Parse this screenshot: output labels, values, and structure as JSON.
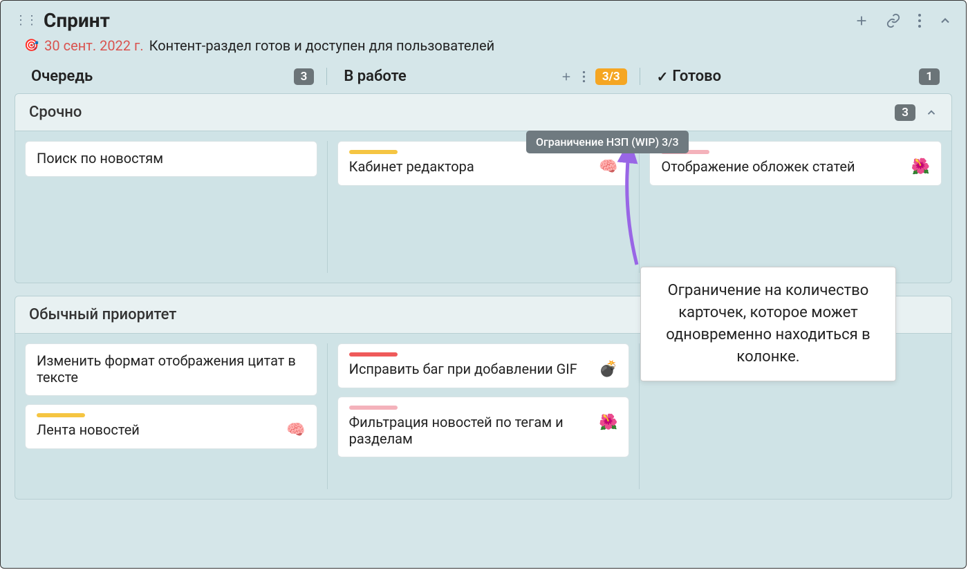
{
  "board": {
    "title": "Спринт",
    "due_date": "30 сент. 2022 г.",
    "goal": "Контент-раздел готов и доступен для пользователей",
    "target_icon": "🎯"
  },
  "columns": [
    {
      "name": "Очередь",
      "count": "3"
    },
    {
      "name": "В работе",
      "wip": "3/3"
    },
    {
      "name": "Готово",
      "count": "1",
      "has_check": true
    }
  ],
  "tooltip": "Ограничение НЗП (WIP) 3/3",
  "callout": "Ограничение на количество карточек, которое может одновременно находиться в колонке.",
  "swimlanes": [
    {
      "title": "Срочно",
      "count": "3",
      "rows": [
        [
          {
            "title": "Поиск по новостям"
          }
        ],
        [
          {
            "title": "Кабинет редактора",
            "stripe": "yellow",
            "emoji": "🧠"
          }
        ],
        [
          {
            "title": "Отображение обложек статей",
            "stripe": "pink",
            "emoji": "🌺"
          }
        ]
      ]
    },
    {
      "title": "Обычный приоритет",
      "rows": [
        [
          {
            "title": "Изменить формат отображения цитат в тексте"
          },
          {
            "title": "Лента новостей",
            "stripe": "yellow",
            "emoji": "🧠"
          }
        ],
        [
          {
            "title": "Исправить баг при добавлении GIF",
            "stripe": "red",
            "emoji": "💣"
          },
          {
            "title": "Фильтрация новостей по тегам и разделам",
            "stripe": "pink",
            "emoji": "🌺"
          }
        ],
        []
      ]
    }
  ]
}
